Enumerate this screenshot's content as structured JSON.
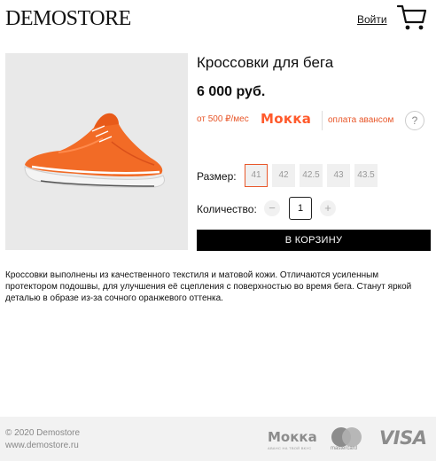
{
  "header": {
    "logo": "DEMOSTORE",
    "login_label": "Войти",
    "cart_icon": "cart-icon"
  },
  "product": {
    "title": "Кроссовки для бега",
    "price": "6 000 руб.",
    "image_alt": "orange-sneaker",
    "credit": {
      "monthly": "от 500 ₽/мес",
      "provider": "Мокка",
      "advance": "оплата авансом",
      "help": "?"
    },
    "size": {
      "label": "Размер:",
      "options": [
        "41",
        "42",
        "42.5",
        "43",
        "43.5"
      ],
      "selected": "41"
    },
    "quantity": {
      "label": "Количество:",
      "minus": "−",
      "value": "1",
      "plus": "+"
    },
    "add_to_cart": "В КОРЗИНУ",
    "description": "Кроссовки выполнены из качественного текстиля и матовой кожи. Отличаются усиленным протектором подошвы, для улучшения её сцепления с поверхностью во время бега. Станут яркой деталью в образе из-за сочного оранжевого оттенка."
  },
  "footer": {
    "copyright": "© 2020 Demostore",
    "site": "www.demostore.ru",
    "payments": {
      "mokka": "Мокка",
      "mokka_tagline": "АВАНС НА ТВОЙ ВКУС",
      "mastercard": "mastercard",
      "visa": "VISA"
    }
  },
  "colors": {
    "accent": "#e8572a",
    "button": "#000000",
    "footer_bg": "#f2f2f2"
  }
}
